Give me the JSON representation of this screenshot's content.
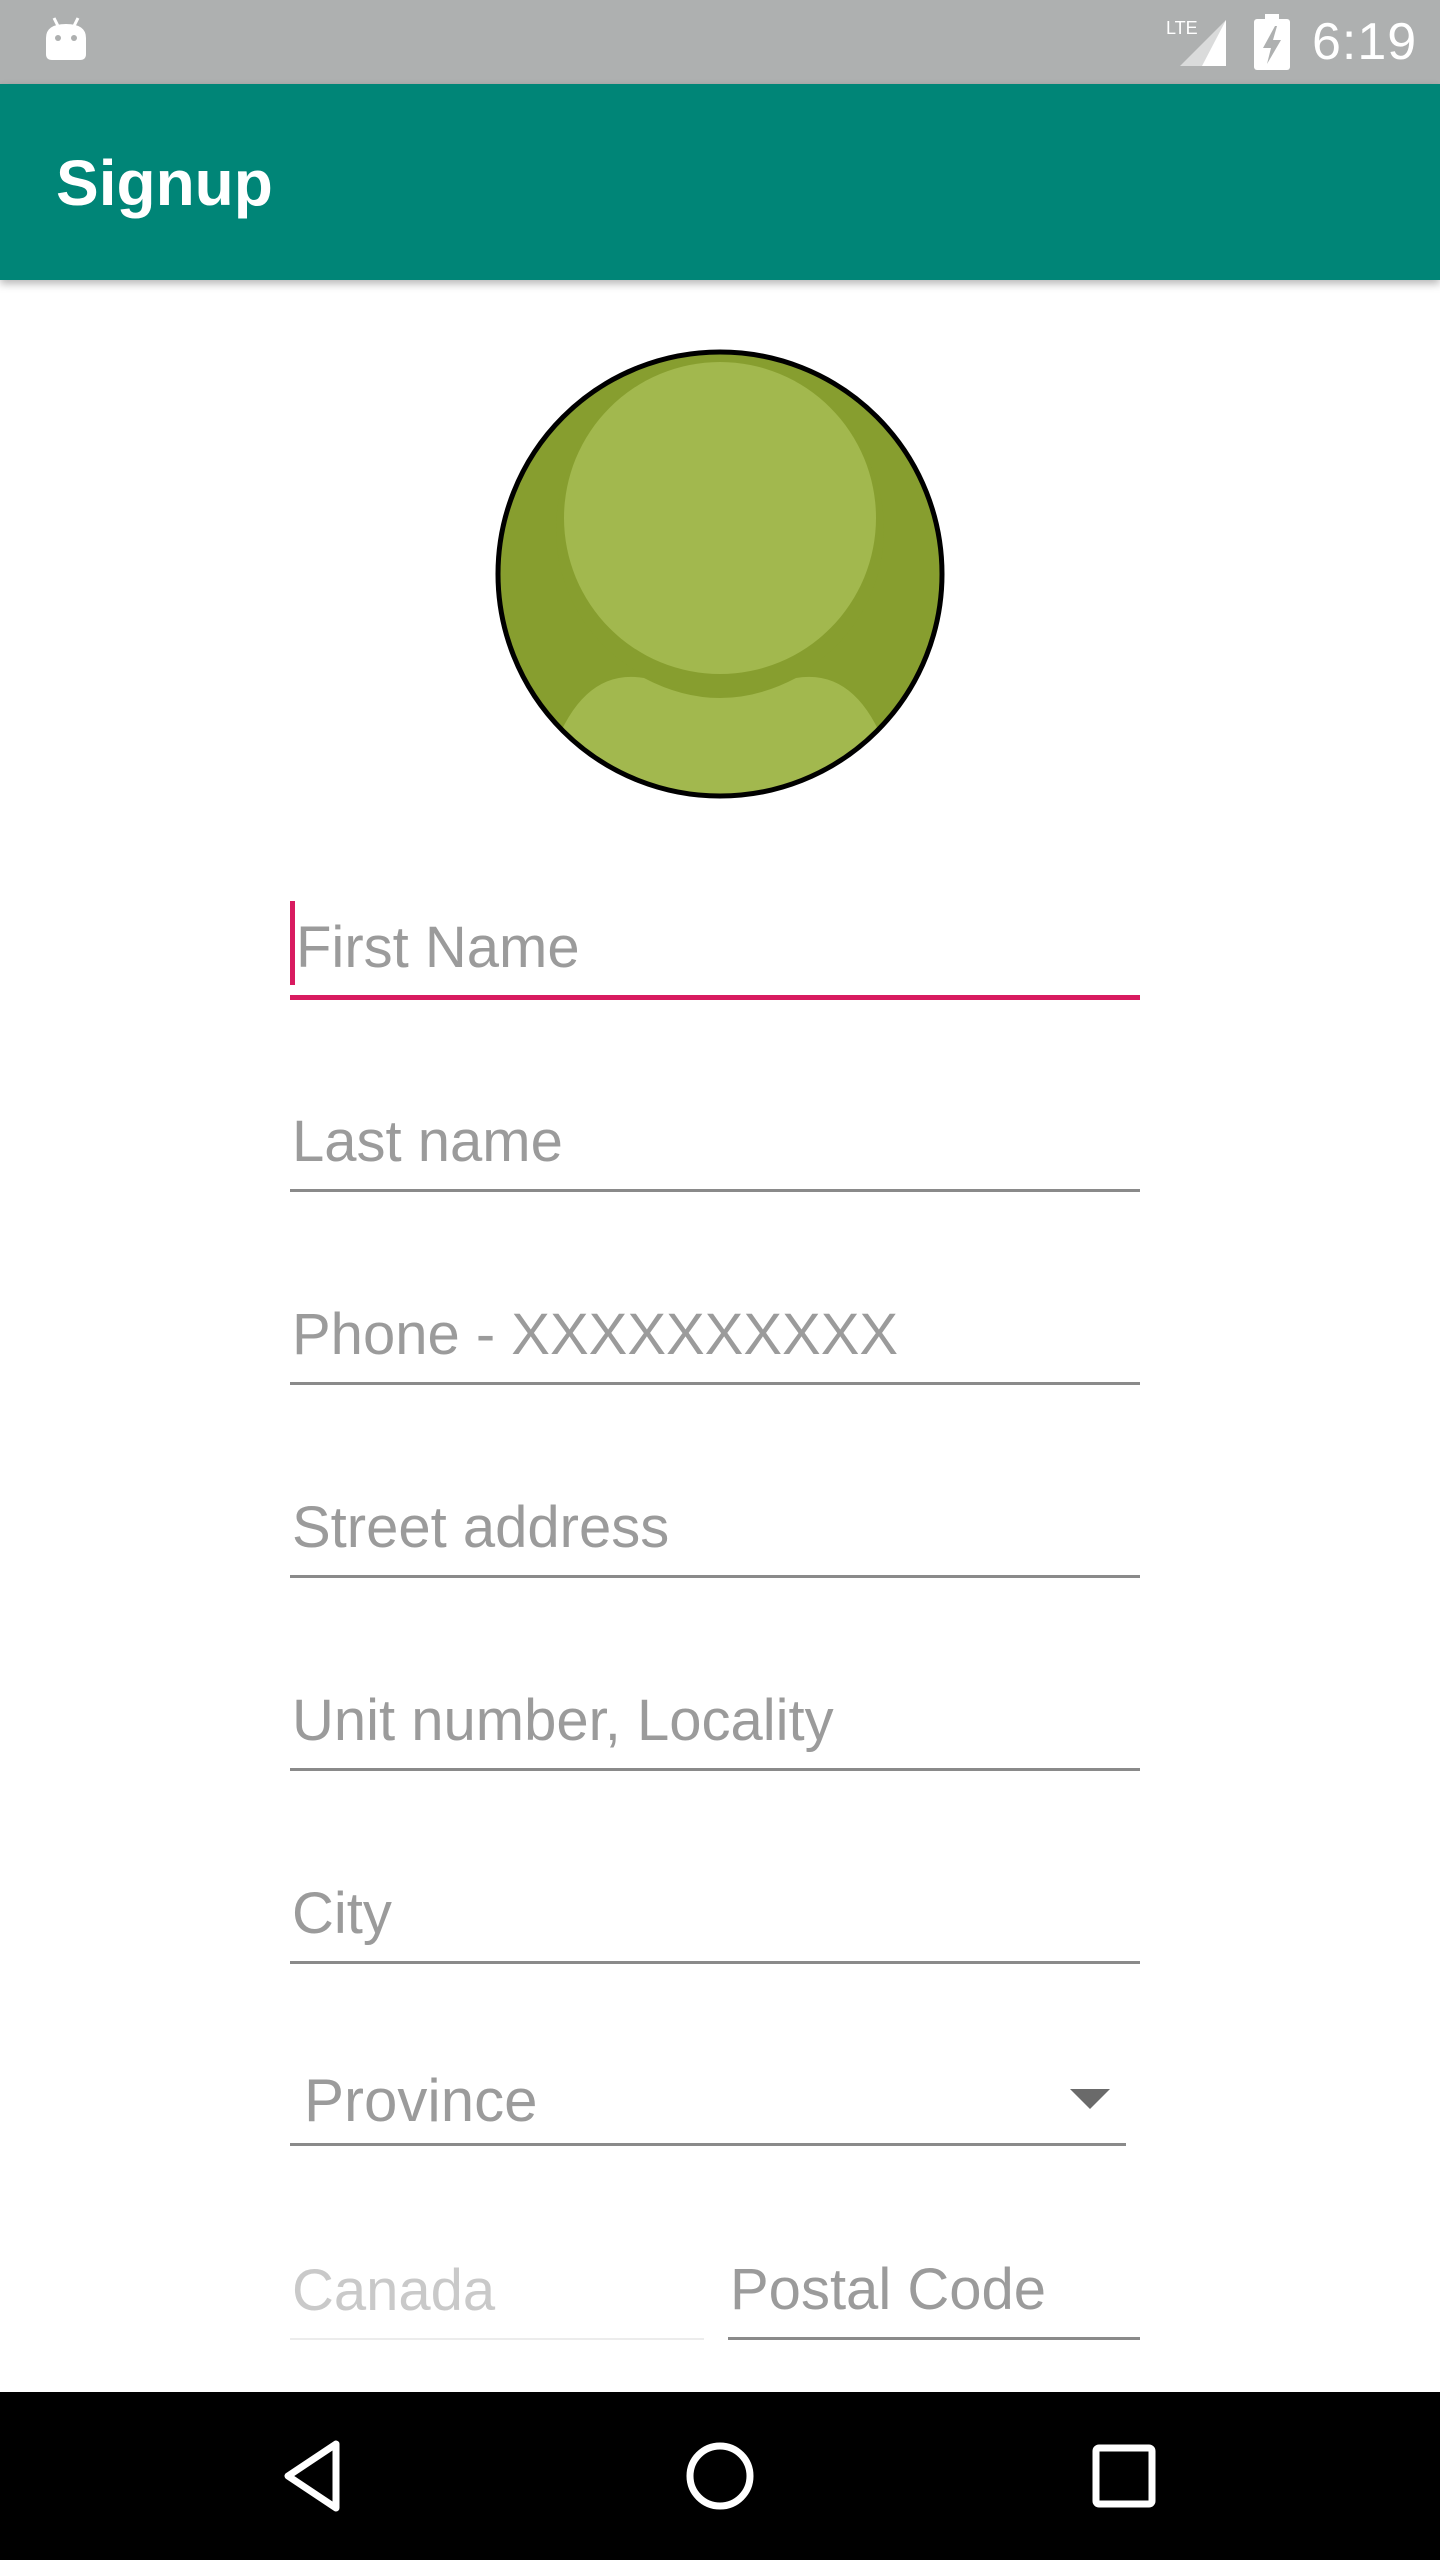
{
  "status_bar": {
    "time": "6:19",
    "network_label": "LTE",
    "icons": [
      "android-icon",
      "lte-signal-icon",
      "battery-charging-icon"
    ]
  },
  "app_bar": {
    "title": "Signup",
    "color": "#008577"
  },
  "avatar": {
    "icon": "user-avatar-icon",
    "colors": {
      "ring": "#000000",
      "outer": "#879e2f",
      "inner": "#a2b84e"
    }
  },
  "form": {
    "first_name": {
      "placeholder": "First Name",
      "focused": true
    },
    "last_name": {
      "placeholder": "Last name"
    },
    "phone": {
      "placeholder": "Phone - XXXXXXXXXX"
    },
    "street": {
      "placeholder": "Street address"
    },
    "unit": {
      "placeholder": "Unit number, Locality"
    },
    "city": {
      "placeholder": "City"
    },
    "province": {
      "selected": "Province"
    },
    "country": {
      "value": "Canada",
      "enabled": false
    },
    "postal_code": {
      "placeholder": "Postal Code"
    }
  },
  "accent_color": "#d81b60",
  "nav_bar": {
    "buttons": [
      "back-icon",
      "home-icon",
      "recents-icon"
    ]
  }
}
